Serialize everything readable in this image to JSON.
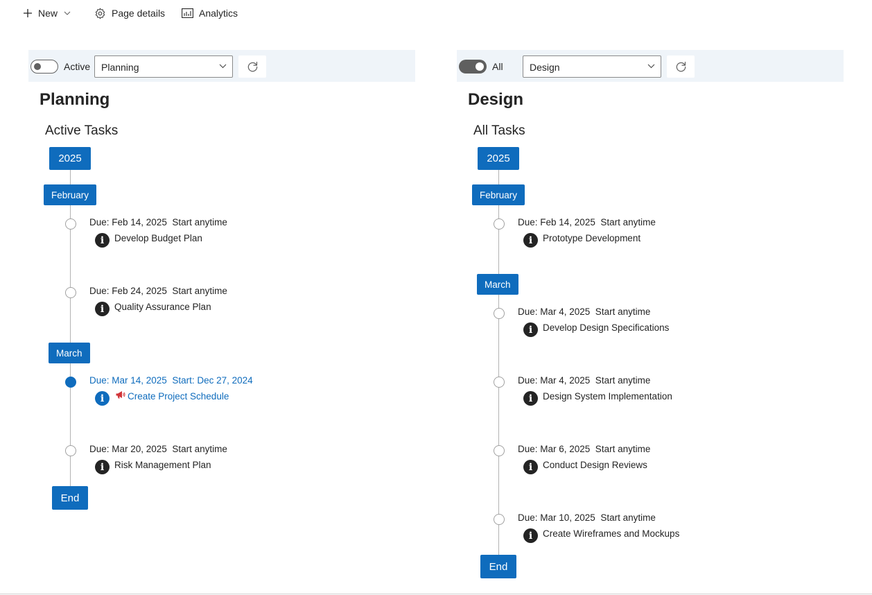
{
  "commandbar": {
    "new_label": "New",
    "page_details_label": "Page details",
    "analytics_label": "Analytics"
  },
  "left_panel": {
    "toggle": {
      "state": "off",
      "label": "Active"
    },
    "select": {
      "value": "Planning"
    },
    "title": "Planning",
    "subtitle": "Active Tasks",
    "year": "2025",
    "months": [
      "February",
      "March"
    ],
    "tasks": [
      {
        "due": "Due: Feb 14, 2025  Start anytime",
        "name": "Develop Budget Plan",
        "highlight": false
      },
      {
        "due": "Due: Feb 24, 2025  Start anytime",
        "name": "Quality Assurance Plan",
        "highlight": false
      },
      {
        "due": "Due: Mar 14, 2025  Start: Dec 27, 2024",
        "name": "Create Project Schedule",
        "highlight": true,
        "alert_icon": "megaphone-icon"
      },
      {
        "due": "Due: Mar 20, 2025  Start anytime",
        "name": "Risk Management Plan",
        "highlight": false
      }
    ],
    "end_label": "End"
  },
  "right_panel": {
    "toggle": {
      "state": "on",
      "label": "All"
    },
    "select": {
      "value": "Design"
    },
    "title": "Design",
    "subtitle": "All Tasks",
    "year": "2025",
    "months": [
      "February",
      "March"
    ],
    "tasks": [
      {
        "due": "Due: Feb 14, 2025  Start anytime",
        "name": "Prototype Development"
      },
      {
        "due": "Due: Mar 4, 2025  Start anytime",
        "name": "Develop Design Specifications"
      },
      {
        "due": "Due: Mar 4, 2025  Start anytime",
        "name": "Design System Implementation"
      },
      {
        "due": "Due: Mar 6, 2025  Start anytime",
        "name": "Conduct Design Reviews"
      },
      {
        "due": "Due: Mar 10, 2025  Start anytime",
        "name": "Create Wireframes and Mockups"
      }
    ],
    "end_label": "End"
  },
  "icons": {
    "info": "i"
  },
  "colors": {
    "accent": "#0f6cbd",
    "filter_bar": "#eff4f9",
    "alert": "#d13438"
  }
}
